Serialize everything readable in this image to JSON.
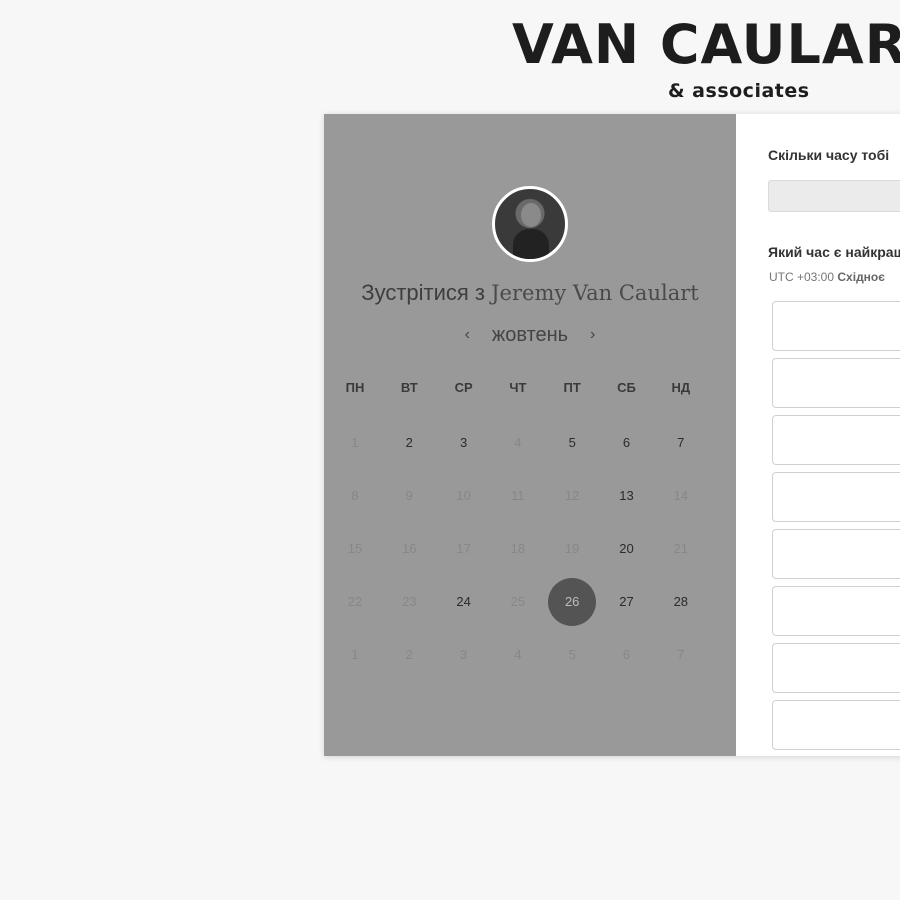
{
  "brand": {
    "name": "VAN CAULAR",
    "subtitle": "& associates"
  },
  "scheduler": {
    "meet_prefix": "Зустрітися з",
    "host_name": "Jeremy Van Caulart",
    "month": "жовтень",
    "prev_month_icon": "chevron-left-icon",
    "next_month_icon": "chevron-right-icon",
    "weekdays": [
      "ПН",
      "ВТ",
      "СР",
      "ЧТ",
      "ПТ",
      "СБ",
      "НД"
    ],
    "weeks": [
      [
        {
          "d": "1",
          "s": "off"
        },
        {
          "d": "2",
          "s": "on"
        },
        {
          "d": "3",
          "s": "on"
        },
        {
          "d": "4",
          "s": "off"
        },
        {
          "d": "5",
          "s": "on"
        },
        {
          "d": "6",
          "s": "on"
        },
        {
          "d": "7",
          "s": "on"
        }
      ],
      [
        {
          "d": "8",
          "s": "off"
        },
        {
          "d": "9",
          "s": "off"
        },
        {
          "d": "10",
          "s": "off"
        },
        {
          "d": "11",
          "s": "off"
        },
        {
          "d": "12",
          "s": "off"
        },
        {
          "d": "13",
          "s": "on"
        },
        {
          "d": "14",
          "s": "off"
        }
      ],
      [
        {
          "d": "15",
          "s": "off"
        },
        {
          "d": "16",
          "s": "off"
        },
        {
          "d": "17",
          "s": "off"
        },
        {
          "d": "18",
          "s": "off"
        },
        {
          "d": "19",
          "s": "off"
        },
        {
          "d": "20",
          "s": "on"
        },
        {
          "d": "21",
          "s": "off"
        }
      ],
      [
        {
          "d": "22",
          "s": "off"
        },
        {
          "d": "23",
          "s": "off"
        },
        {
          "d": "24",
          "s": "on"
        },
        {
          "d": "25",
          "s": "off"
        },
        {
          "d": "26",
          "s": "sel"
        },
        {
          "d": "27",
          "s": "on"
        },
        {
          "d": "28",
          "s": "on"
        }
      ],
      [
        {
          "d": "1",
          "s": "off"
        },
        {
          "d": "2",
          "s": "off"
        },
        {
          "d": "3",
          "s": "off"
        },
        {
          "d": "4",
          "s": "off"
        },
        {
          "d": "5",
          "s": "off"
        },
        {
          "d": "6",
          "s": "off"
        },
        {
          "d": "7",
          "s": "off"
        }
      ]
    ]
  },
  "booking": {
    "duration_question": "Скільки часу тобі",
    "duration_value": "",
    "time_question": "Який час є найкращ",
    "timezone_offset": "UTC +03:00",
    "timezone_name": "Східноє",
    "time_slots": [
      "",
      "",
      "",
      "",
      "",
      "",
      "",
      ""
    ]
  },
  "colors": {
    "left_panel": "#999999",
    "selected_day": "#545454",
    "background": "#f7f7f7"
  }
}
